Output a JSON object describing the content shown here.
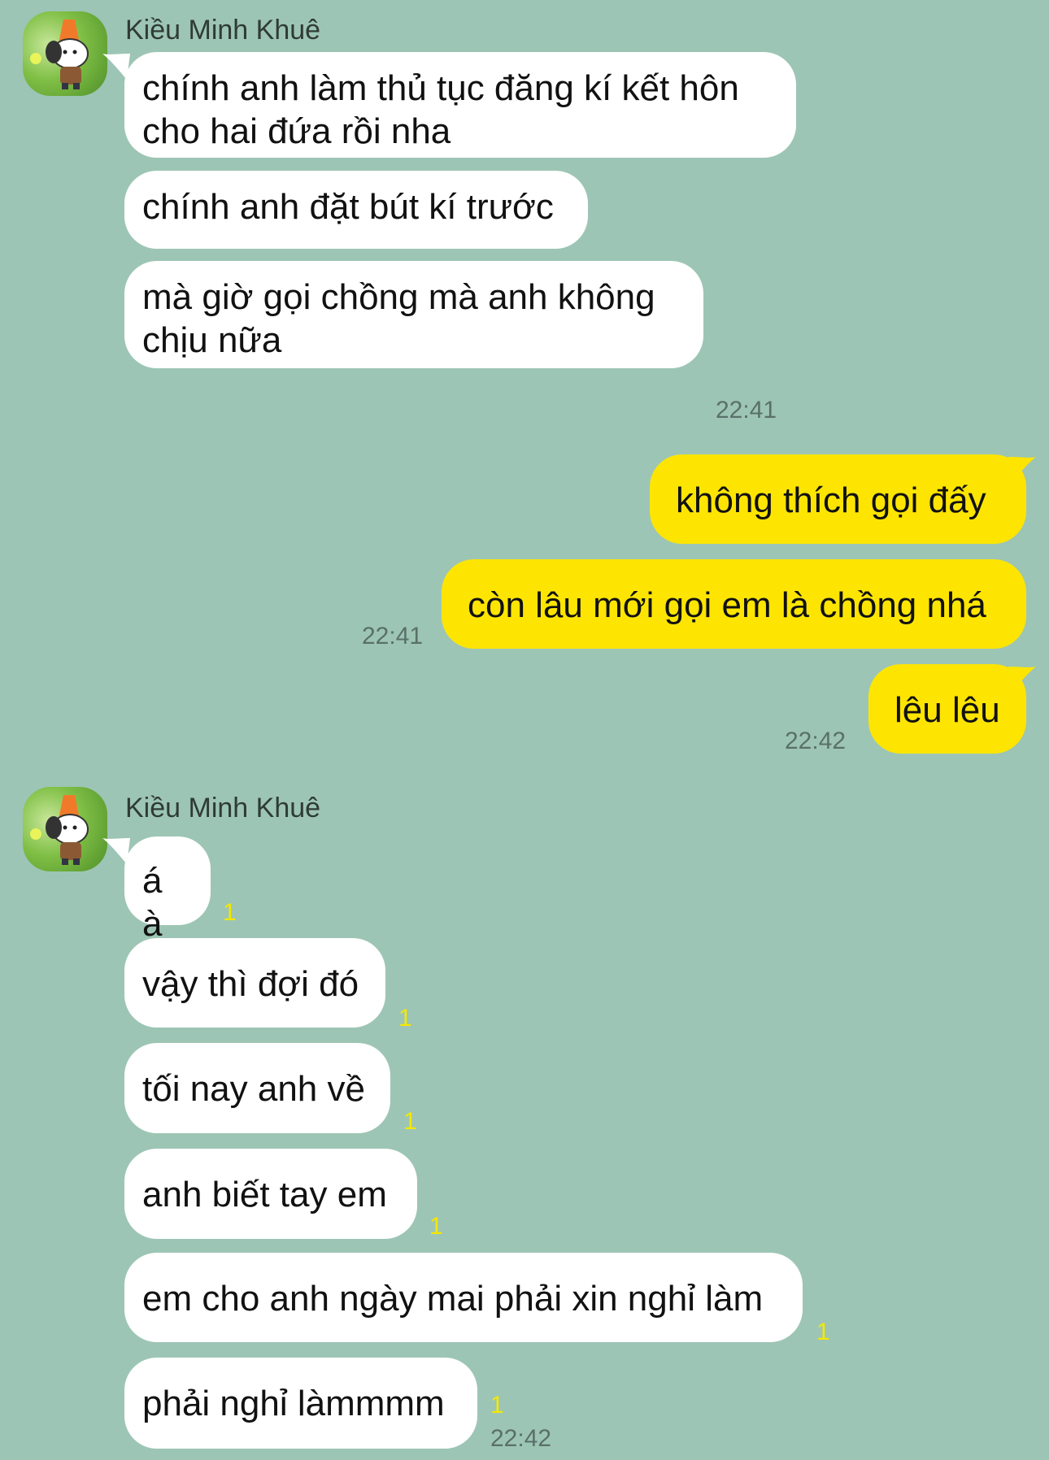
{
  "colors": {
    "background": "#9dc5b5",
    "incoming_bubble": "#ffffff",
    "outgoing_bubble": "#fde501",
    "read_count": "#f4e800"
  },
  "groups": [
    {
      "sender": "Kiều Minh Khuê",
      "messages": [
        {
          "text": "chính anh làm thủ tục đăng kí kết hôn\ncho hai đứa rồi nha"
        },
        {
          "text": "chính anh đặt bút kí trước"
        },
        {
          "text": "mà giờ gọi chồng mà anh không\nchịu nữa",
          "time": "22:41"
        }
      ]
    },
    {
      "messages": [
        {
          "text": "không thích gọi đấy"
        },
        {
          "text": "còn lâu mới gọi em là chồng nhá",
          "time": "22:41"
        },
        {
          "text": "lêu lêu",
          "time": "22:42"
        }
      ]
    },
    {
      "sender": "Kiều Minh Khuê",
      "messages": [
        {
          "text": "á à",
          "read": "1"
        },
        {
          "text": "vậy thì đợi đó",
          "read": "1"
        },
        {
          "text": "tối nay anh về",
          "read": "1"
        },
        {
          "text": "anh biết tay em",
          "read": "1"
        },
        {
          "text": "em cho anh ngày mai phải xin nghỉ làm",
          "read": "1"
        },
        {
          "text": "phải nghỉ làmmmm",
          "read": "1",
          "time": "22:42"
        }
      ]
    }
  ]
}
